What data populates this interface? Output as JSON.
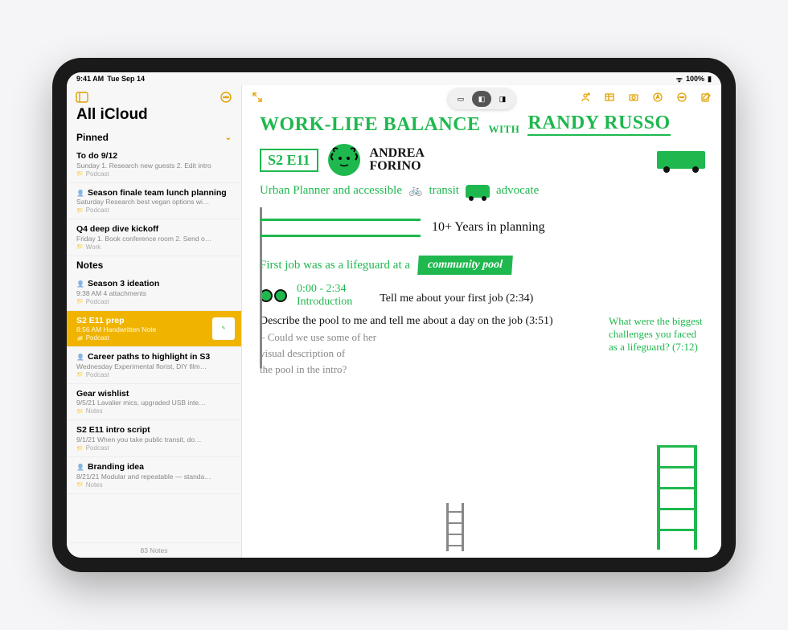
{
  "status": {
    "time": "9:41 AM",
    "date": "Tue Sep 14",
    "battery": "100%"
  },
  "sidebar": {
    "title": "All iCloud",
    "pinned_header": "Pinned",
    "notes_header": "Notes",
    "count": "83 Notes",
    "pinned": [
      {
        "title": "To do 9/12",
        "meta": "Sunday  1. Research new guests 2. Edit intro",
        "folder": "Podcast",
        "shared": false
      },
      {
        "title": "Season finale team lunch planning",
        "meta": "Saturday  Research best vegan options wi…",
        "folder": "Podcast",
        "shared": true
      },
      {
        "title": "Q4 deep dive kickoff",
        "meta": "Friday  1. Book conference room 2. Send o…",
        "folder": "Work",
        "shared": false
      }
    ],
    "notes": [
      {
        "title": "Season 3 ideation",
        "meta": "9:38 AM  4 attachments",
        "folder": "Podcast",
        "shared": true,
        "selected": false
      },
      {
        "title": "S2 E11 prep",
        "meta": "8:56 AM  Handwritten Note",
        "folder": "Podcast",
        "shared": false,
        "selected": true
      },
      {
        "title": "Career paths to highlight in S3",
        "meta": "Wednesday  Experimental florist, DIY film…",
        "folder": "Podcast",
        "shared": true,
        "selected": false
      },
      {
        "title": "Gear wishlist",
        "meta": "9/5/21  Lavalier mics, upgraded USB inte…",
        "folder": "Notes",
        "shared": false,
        "selected": false
      },
      {
        "title": "S2 E11 intro script",
        "meta": "9/1/21  When you take public transit, do…",
        "folder": "Podcast",
        "shared": false,
        "selected": false
      },
      {
        "title": "Branding idea",
        "meta": "8/21/21  Modular and repeatable — standa…",
        "folder": "Notes",
        "shared": true,
        "selected": false
      }
    ]
  },
  "note": {
    "title_a": "WORK-LIFE BALANCE",
    "title_with": "WITH",
    "title_b": "RANDY RUSSO",
    "episode": "S2 E11",
    "guest_first": "ANDREA",
    "guest_last": "FORINO",
    "subtitle_a": "Urban Planner and accessible",
    "subtitle_b": "transit",
    "subtitle_c": "advocate",
    "years": "10+ Years in planning",
    "firstjob": "First job was as a lifeguard at a",
    "pool": "community pool",
    "tc1": "0:00 - 2:34",
    "intro": "Introduction",
    "q1": "Tell me about your first job (2:34)",
    "q2": "Describe the pool to me and tell me about a day on the job (3:51)",
    "q3a": "– Could we use some of her",
    "q3b": "visual description of",
    "q3c": "the pool in the intro?",
    "q4": "What were the biggest challenges you faced as a lifeguard? (7:12)"
  }
}
